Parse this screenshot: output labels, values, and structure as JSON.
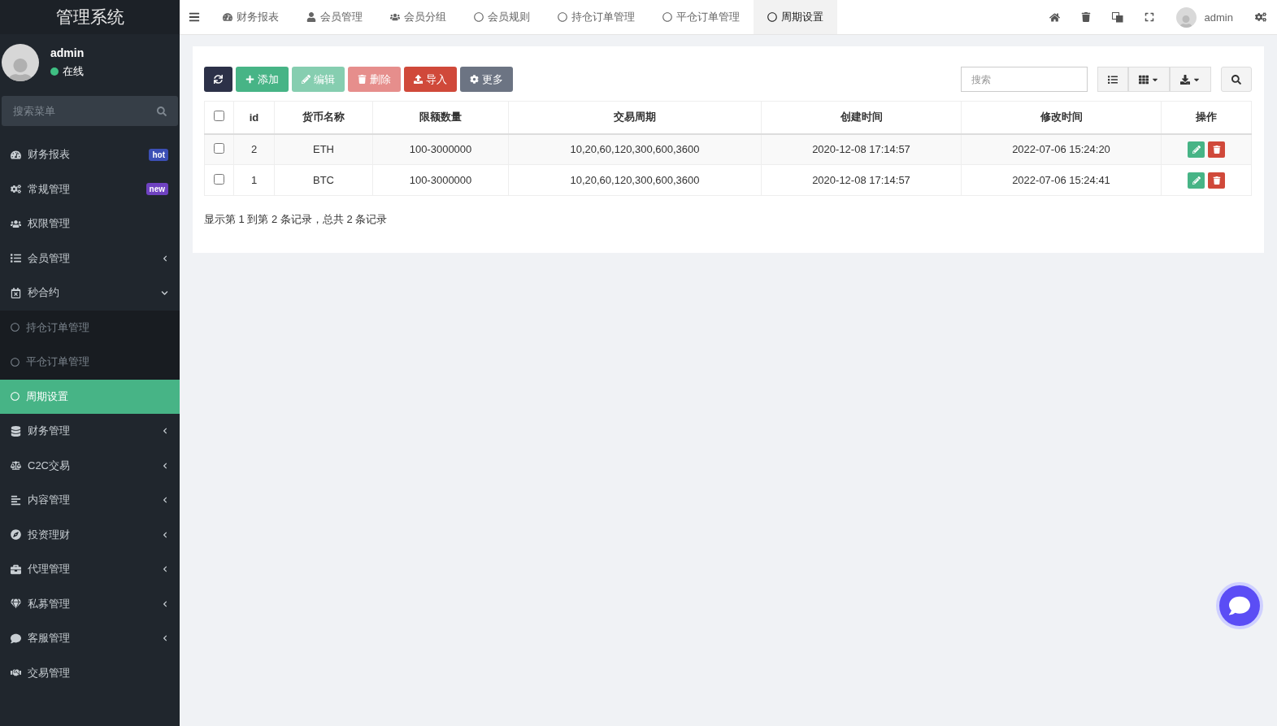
{
  "sidebar": {
    "title": "管理系统",
    "user": {
      "name": "admin",
      "status": "在线"
    },
    "search": {
      "placeholder": "搜索菜单"
    },
    "items": [
      {
        "label": "财务报表",
        "badge": "hot",
        "color": "#3c4fb5",
        "selected": false
      },
      {
        "label": "常规管理",
        "badge": "new",
        "color": "#6f42c1",
        "selected": false
      },
      {
        "label": "权限管理",
        "selected": false
      },
      {
        "label": "会员管理",
        "expanded": false,
        "selected": false
      },
      {
        "label": "秒合约",
        "expanded": true,
        "selected": false,
        "children": [
          {
            "label": "持仓订单管理",
            "selected": false
          },
          {
            "label": "平仓订单管理",
            "selected": false
          },
          {
            "label": "周期设置",
            "selected": true
          }
        ]
      },
      {
        "label": "财务管理",
        "expanded": false,
        "selected": false
      },
      {
        "label": "C2C交易",
        "expanded": false,
        "selected": false
      },
      {
        "label": "内容管理",
        "expanded": false,
        "selected": false
      },
      {
        "label": "投资理财",
        "expanded": false,
        "selected": false
      },
      {
        "label": "代理管理",
        "expanded": false,
        "selected": false
      },
      {
        "label": "私募管理",
        "expanded": false,
        "selected": false
      },
      {
        "label": "客服管理",
        "expanded": false,
        "selected": false
      },
      {
        "label": "交易管理",
        "selected": false
      }
    ]
  },
  "tabs": [
    {
      "label": "财务报表",
      "selected": false
    },
    {
      "label": "会员管理",
      "selected": false
    },
    {
      "label": "会员分组",
      "selected": false
    },
    {
      "label": "会员规则",
      "selected": false
    },
    {
      "label": "持仓订单管理",
      "selected": false
    },
    {
      "label": "平仓订单管理",
      "selected": false
    },
    {
      "label": "周期设置",
      "selected": true
    }
  ],
  "topbar": {
    "user": "admin"
  },
  "toolbar": [
    {
      "kind": "refresh",
      "disabled": false
    },
    {
      "kind": "add",
      "label": "添加",
      "disabled": false
    },
    {
      "kind": "edit",
      "label": "编辑",
      "disabled": true
    },
    {
      "kind": "delete",
      "label": "删除",
      "disabled": true
    },
    {
      "kind": "import",
      "label": "导入",
      "disabled": false
    },
    {
      "kind": "more",
      "label": "更多",
      "disabled": false
    }
  ],
  "table_search": {
    "placeholder": "搜索"
  },
  "table": {
    "select_all_checked": false,
    "columns": [
      "id",
      "货币名称",
      "限额数量",
      "交易周期",
      "创建时间",
      "修改时间",
      "操作"
    ],
    "rows": [
      {
        "checked": false,
        "cells": [
          "2",
          "ETH",
          "100-3000000",
          "10,20,60,120,300,600,3600",
          "2020-12-08 17:14:57",
          "2022-07-06 15:24:20"
        ]
      },
      {
        "checked": false,
        "cells": [
          "1",
          "BTC",
          "100-3000000",
          "10,20,60,120,300,600,3600",
          "2020-12-08 17:14:57",
          "2022-07-06 15:24:41"
        ]
      }
    ]
  },
  "pagination_info": "显示第 1 到第 2 条记录，总共 2 条记录"
}
